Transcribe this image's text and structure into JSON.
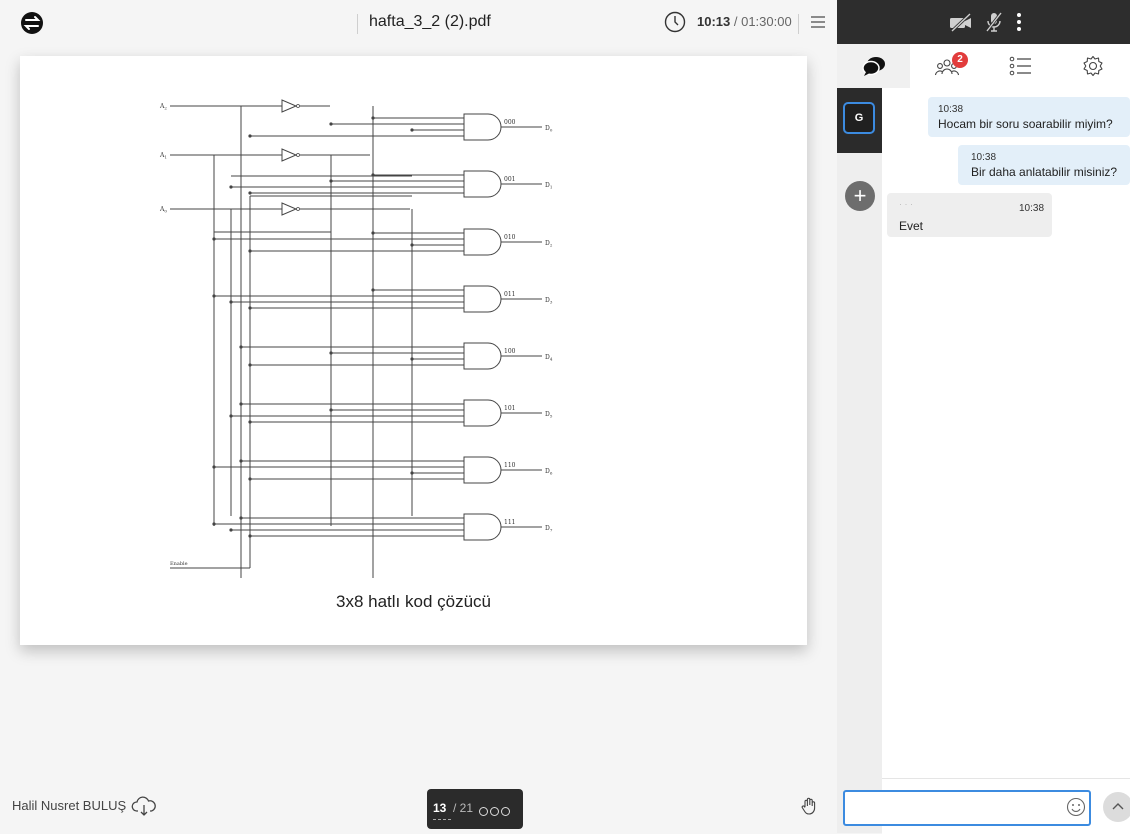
{
  "viewer": {
    "document_title": "hafta_3_2 (2).pdf",
    "timer_elapsed": "10:13",
    "timer_separator": " / ",
    "timer_total": "01:30:00",
    "presenter_name": "Halil Nusret BULUŞ"
  },
  "slide": {
    "caption": "3x8 hatlı kod çözücü",
    "inputs": [
      "A2",
      "A1",
      "A0"
    ],
    "enable_label": "Enable",
    "outputs": [
      {
        "code": "000",
        "line": "D0"
      },
      {
        "code": "001",
        "line": "D1"
      },
      {
        "code": "010",
        "line": "D2"
      },
      {
        "code": "011",
        "line": "D3"
      },
      {
        "code": "100",
        "line": "D4"
      },
      {
        "code": "101",
        "line": "D5"
      },
      {
        "code": "110",
        "line": "D6"
      },
      {
        "code": "111",
        "line": "D7"
      }
    ]
  },
  "pager": {
    "current": "13",
    "total": "/ 21"
  },
  "tabs": {
    "participants_badge": "2",
    "items": [
      "chat-icon",
      "participants-icon",
      "list-icon",
      "settings-icon"
    ]
  },
  "rail": {
    "avatar_initial": "G",
    "add_label": "+"
  },
  "chat": {
    "messages": [
      {
        "direction": "out",
        "time": "10:38",
        "text": "Hocam bir soru soarabilir miyim?"
      },
      {
        "direction": "out",
        "time": "10:38",
        "text": "Bir daha anlatabilir misiniz?"
      },
      {
        "direction": "in",
        "time": "10:38",
        "text": "Evet"
      }
    ],
    "input_value": "",
    "input_placeholder": ""
  },
  "colors": {
    "accent": "#3c8be0",
    "badge": "#e23c3c",
    "dark": "#2d2d2d",
    "bubble_out": "#e3eff9"
  }
}
